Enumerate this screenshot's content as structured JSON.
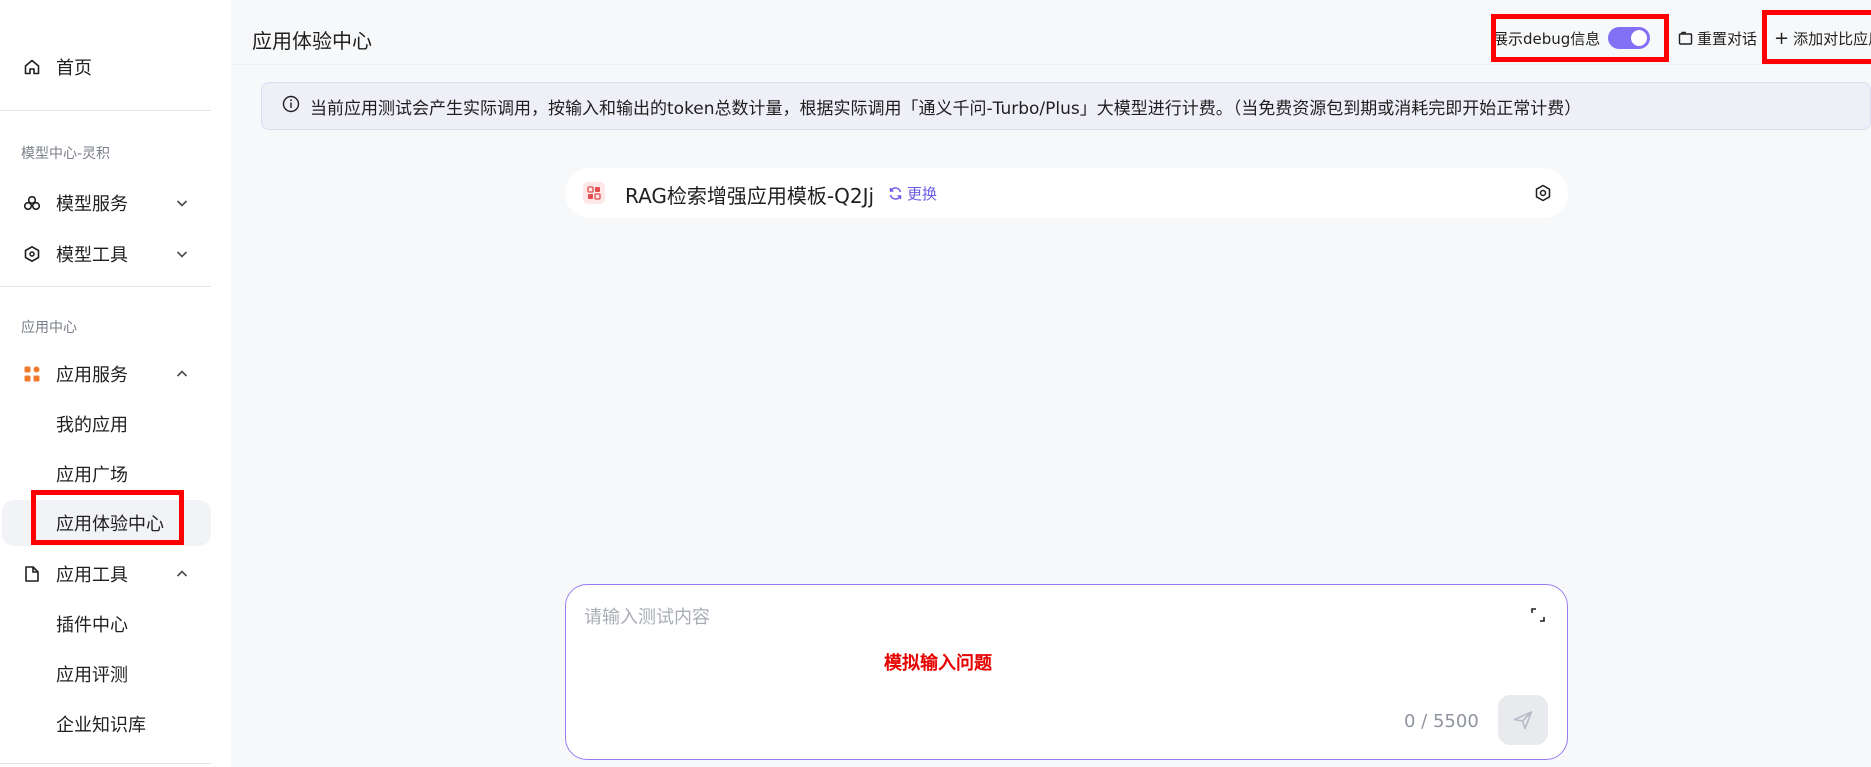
{
  "sidebar": {
    "home": "首页",
    "section_model": "模型中心-灵积",
    "model_service": "模型服务",
    "model_tools": "模型工具",
    "section_app": "应用中心",
    "app_service": "应用服务",
    "my_apps": "我的应用",
    "app_square": "应用广场",
    "app_experience": "应用体验中心",
    "app_tools": "应用工具",
    "plugin_center": "插件中心",
    "app_evaluation": "应用评测",
    "enterprise_kb": "企业知识库"
  },
  "header": {
    "title": "应用体验中心",
    "debug_label": "展示debug信息",
    "debug_on": true,
    "reset_label": "重置对话",
    "add_compare_label": "添加对比应用"
  },
  "notice": {
    "text": "当前应用测试会产生实际调用，按输入和输出的token总数计量，根据实际调用「通义千问-Turbo/Plus」大模型进行计费。（当免费资源包到期或消耗完即开始正常计费）"
  },
  "app_card": {
    "name": "RAG检索增强应用模板-Q2Jj",
    "change_label": "更换"
  },
  "input": {
    "placeholder": "请输入测试内容",
    "annotation": "模拟输入问题",
    "counter": "0 / 5500"
  },
  "colors": {
    "accent": "#8470f4",
    "link": "#6c5ce7",
    "highlight": "#ff0000",
    "annotation": "#e60000"
  }
}
